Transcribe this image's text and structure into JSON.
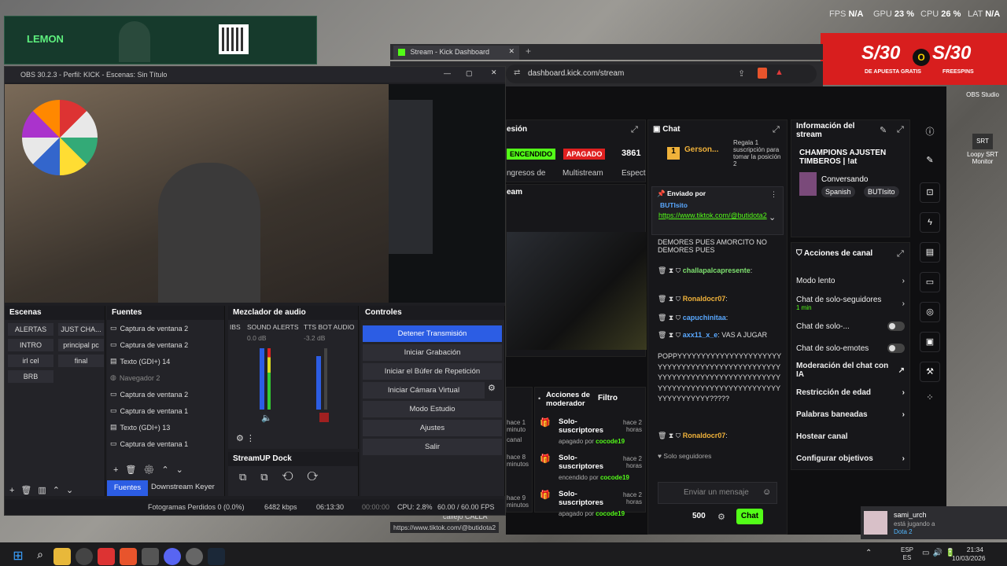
{
  "hud": {
    "fps_label": "FPS",
    "fps_val": "N/A",
    "gpu_label": "GPU",
    "gpu_val": "23 %",
    "cpu_label": "CPU",
    "cpu_val": "26 %",
    "lat_label": "LAT",
    "lat_val": "N/A"
  },
  "overlay": {
    "brand": "LEMON"
  },
  "promo": {
    "amount1": "S/30",
    "or": "O",
    "amount2": "S/30",
    "sub1": "DE APUESTA GRATIS",
    "sub2": "FREESPINS"
  },
  "desktop_icons": [
    {
      "label": "OBS Studio"
    },
    {
      "label": "Loopy SRT Monitor"
    }
  ],
  "obs": {
    "title": "OBS 30.2.3 - Perfil: KICK - Escenas: Sin Título",
    "docks": {
      "scenes": "Escenas",
      "sources": "Fuentes",
      "mixer": "Mezclador de audio",
      "controls": "Controles",
      "streamup": "StreamUP Dock"
    },
    "scenes": [
      "ALERTAS",
      "JUST CHA...",
      "INTRO",
      "principal pc",
      "irl cel",
      "final",
      "BRB"
    ],
    "sources": [
      "Captura de ventana 2",
      "Captura de ventana 2",
      "Texto (GDI+) 14",
      "Navegador 2",
      "Captura de ventana 2",
      "Captura de ventana 1",
      "Texto (GDI+) 13",
      "Captura de ventana 1"
    ],
    "mixer": {
      "ch0": "IBS",
      "ch1": "SOUND ALERTS",
      "ch1_db": "0.0 dB",
      "ch2": "TTS BOT AUDIO",
      "ch2_db": "-3.2 dB",
      "ticks": [
        "0",
        "-5",
        "-10",
        "-15",
        "-20",
        "-25",
        "-30",
        "-35",
        "-40",
        "-45",
        "-50",
        "-55",
        "-60"
      ]
    },
    "controls": [
      "Detener Transmisión",
      "Iniciar Grabación",
      "Iniciar el Búfer de Repetición",
      "Iniciar Cámara Virtual",
      "Modo Estudio",
      "Ajustes",
      "Salir"
    ],
    "tabs": {
      "sources": "Fuentes",
      "keyer": "Downstream Keyer"
    },
    "status": {
      "dropped": "Fotogramas Perdidos 0 (0.0%)",
      "kbps": "6482 kbps",
      "live_time": "06:13:30",
      "rec_time": "00:00:00",
      "cpu": "CPU: 2.8%",
      "fps": "60.00 / 60.00 FPS"
    }
  },
  "browser": {
    "tab_title": "Stream - Kick Dashboard",
    "url": "dashboard.kick.com/stream",
    "status_url": "https://www.tiktok.com/@butidota2"
  },
  "kick": {
    "session": {
      "title": "esión",
      "on": "ENCENDIDO",
      "off": "APAGADO",
      "viewers": "3861",
      "label1": "ngresos de",
      "label2": "Multistream",
      "label3": "Espect",
      "stream_label": "eam"
    },
    "chat": {
      "title": "Chat",
      "top_user": "Gerson...",
      "top_rank": "1",
      "gift_text": "Regala 1 suscripción para tomar la posición 2",
      "pinned_label": "Enviado por",
      "pinned_user": "BUTIsito",
      "pinned_link": "https://www.tiktok.com/@butidota2",
      "messages": [
        {
          "user": "",
          "text": "DEMORES PUES AMORCITO NO DEMORES PUES"
        },
        {
          "user": "challapalcapresente",
          "text": ":"
        },
        {
          "user": "Ronaldocr07",
          "text": ":"
        },
        {
          "user": "capuchinitaa",
          "text": ":"
        },
        {
          "user": "axx11_x_e",
          "text": ": VAS A JUGAR"
        },
        {
          "user": "",
          "text": "POPPYYYYYYYYYYYYYYYYYYYYYYYYYYYYYYYYYYYYYYYYYYYYYYYYYYYYYYYYYYYYYYYYYYYYYYYYYYYYYYYYYYYYYYYYYYYYYYYYYYYYYYYYYYYYYYY?????"
        },
        {
          "user": "Ronaldocr07",
          "text": ":"
        }
      ],
      "followers_only": "Solo seguidores",
      "placeholder": "Enviar un mensaje",
      "count": "500",
      "send": "Chat"
    },
    "info": {
      "title": "Información del stream",
      "stream_title": "CHAMPIONS AJUSTEN TIMBEROS | !at",
      "category": "Conversando",
      "tags": [
        "Spanish",
        "BUTIsito"
      ]
    },
    "actions": {
      "title": "Acciones de canal",
      "rows": [
        {
          "label": "Modo lento",
          "type": "arrow",
          "sub": ""
        },
        {
          "label": "Chat de solo-seguidores",
          "type": "arrow",
          "sub": "1 min"
        },
        {
          "label": "Chat de solo-...",
          "type": "toggle",
          "sub": ""
        },
        {
          "label": "Chat de solo-emotes",
          "type": "toggle",
          "sub": ""
        },
        {
          "label": "Moderación del chat con IA",
          "type": "link",
          "sub": ""
        },
        {
          "label": "Restricción de edad",
          "type": "arrow",
          "sub": ""
        },
        {
          "label": "Palabras baneadas",
          "type": "arrow",
          "sub": ""
        },
        {
          "label": "Hostear canal",
          "type": "none",
          "sub": ""
        },
        {
          "label": "Configurar objetivos",
          "type": "arrow",
          "sub": ""
        }
      ]
    },
    "mod": {
      "title": "Acciones de moderador",
      "filter": "Filtro",
      "items": [
        {
          "title": "Solo-suscriptores",
          "time": "hace 2 horas",
          "state": "apagado por",
          "by": "cocode19"
        },
        {
          "title": "Solo-suscriptores",
          "time": "hace 2 horas",
          "state": "encendido por",
          "by": "cocode19"
        },
        {
          "title": "Solo-suscriptores",
          "time": "hace 2 horas",
          "state": "apagado por",
          "by": "cocode19"
        }
      ],
      "side_times": [
        "hace 1 minuto",
        "canal",
        "hace 8 minutos",
        "hace 9 minutos"
      ]
    },
    "calla": "callejo CALLA"
  },
  "notification": {
    "user": "sami_urch",
    "status": "está jugando a",
    "game": "Dota 2"
  },
  "tray": {
    "lang1": "ESP",
    "lang2": "ES",
    "time": "21:34",
    "date": "10/03/2026"
  },
  "colors": {
    "kick_green": "#53fc18",
    "obs_blue": "#2c5de4",
    "live_red": "#e02020"
  }
}
